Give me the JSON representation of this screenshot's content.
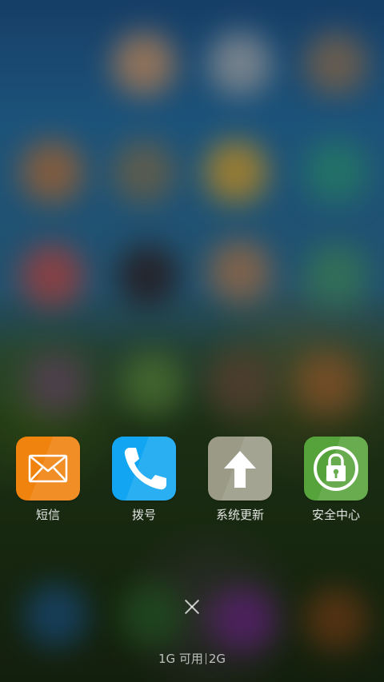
{
  "apps": [
    {
      "label": "短信",
      "icon": "mail-icon",
      "color": "#F0820E"
    },
    {
      "label": "拨号",
      "icon": "phone-icon",
      "color": "#12A6F2"
    },
    {
      "label": "系统更新",
      "icon": "arrow-up-icon",
      "color": "#9A9A86"
    },
    {
      "label": "安全中心",
      "icon": "security-lock-icon",
      "color": "#57A33B"
    }
  ],
  "close_icon": "close-icon",
  "memory": {
    "available": "1G 可用",
    "total": "2G"
  }
}
